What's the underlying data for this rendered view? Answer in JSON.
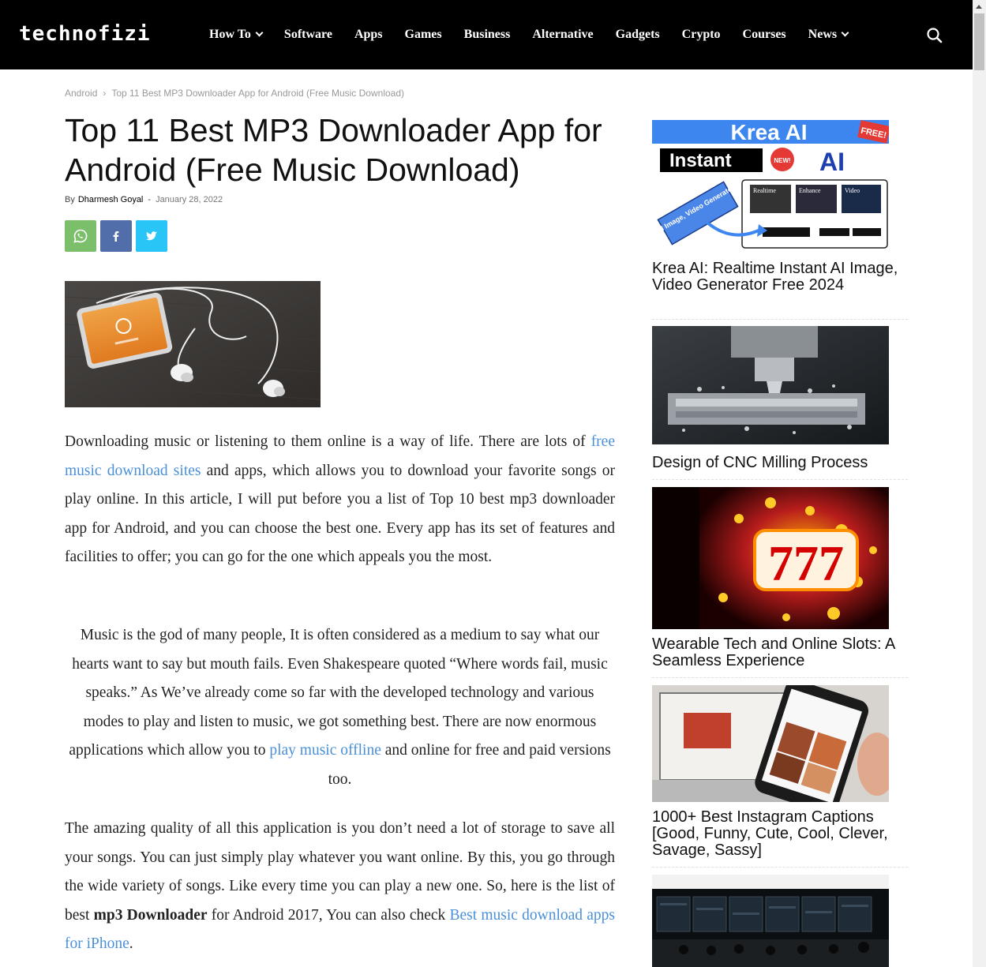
{
  "header": {
    "logo": "technofizi",
    "nav": [
      {
        "label": "How To",
        "dropdown": true
      },
      {
        "label": "Software",
        "dropdown": false
      },
      {
        "label": "Apps",
        "dropdown": false
      },
      {
        "label": "Games",
        "dropdown": false
      },
      {
        "label": "Business",
        "dropdown": false
      },
      {
        "label": "Alternative",
        "dropdown": false
      },
      {
        "label": "Gadgets",
        "dropdown": false
      },
      {
        "label": "Crypto",
        "dropdown": false
      },
      {
        "label": "Courses",
        "dropdown": false
      },
      {
        "label": "News",
        "dropdown": true
      }
    ],
    "search_icon": "search-icon"
  },
  "breadcrumb": {
    "category": "Android",
    "separator": "›",
    "current": "Top 11 Best MP3 Downloader App for Android (Free Music Download)"
  },
  "article": {
    "title": "Top 11 Best MP3 Downloader App for Android (Free Music Download)",
    "by_label": "By",
    "author": "Dharmesh Goyal",
    "dash": "-",
    "date": "January 28, 2022",
    "share": [
      {
        "icon": "whatsapp-icon",
        "color": "#7bbf6a"
      },
      {
        "icon": "facebook-icon",
        "color": "#516eab"
      },
      {
        "icon": "twitter-icon",
        "color": "#29c5f6"
      }
    ],
    "p1": {
      "t1": "Downloading music or listening to them online is a way of life. There are lots of ",
      "link1": "free music download sites",
      "t2": " and apps, which allows you to download your favorite songs or play online.  In this article, I will put before you a list of Top 10 best mp3 downloader app for Android, and you can choose the best one. Every app has its set of features and facilities to offer; you can go for the one which appeals you the most."
    },
    "p2": {
      "t1": "Music is the god of many people, It is often considered as a medium to say what our hearts want to say but mouth fails. Even Shakespeare quoted “Where words fail, music speaks.” As We’ve already come so far with the developed technology and various modes to play and listen to music, we got something best. There are now enormous applications which allow you to ",
      "link1": "play music offline",
      "t2": " and online for free and paid versions too."
    },
    "p3": {
      "t1": "The amazing quality of all this application is you don’t need a lot of storage to save all your songs. You can just simply play whatever you want online. By this, you go through the wide variety of songs. Like every time you can play a new one. So, here is the list of best ",
      "bold1": "mp3 Downloader",
      "t2": " for Android 2017, You can also check ",
      "link1": "Best music download apps for iPhone",
      "t3": "."
    },
    "link_color": "#4a90d9"
  },
  "sidebar": {
    "posts": [
      {
        "title": "Krea AI: Realtime Instant AI Image, Video Generator Free 2024",
        "image_text": {
          "brand": "Krea AI",
          "free": "FREE!",
          "instant": "Instant",
          "new": "NEW!",
          "ai": "AI",
          "ribbon": "AI Image, Video Generator",
          "tab1": "Realtime",
          "tab2": "Enhance",
          "tab3": "Video"
        }
      },
      {
        "title": "Design of CNC Milling Process"
      },
      {
        "title": "Wearable Tech and Online Slots: A Seamless Experience",
        "image_text": {
          "digits": "777"
        }
      },
      {
        "title": "1000+ Best Instagram Captions [Good, Funny, Cute, Cool, Clever, Savage, Sassy]"
      },
      {
        "title": ""
      }
    ]
  }
}
